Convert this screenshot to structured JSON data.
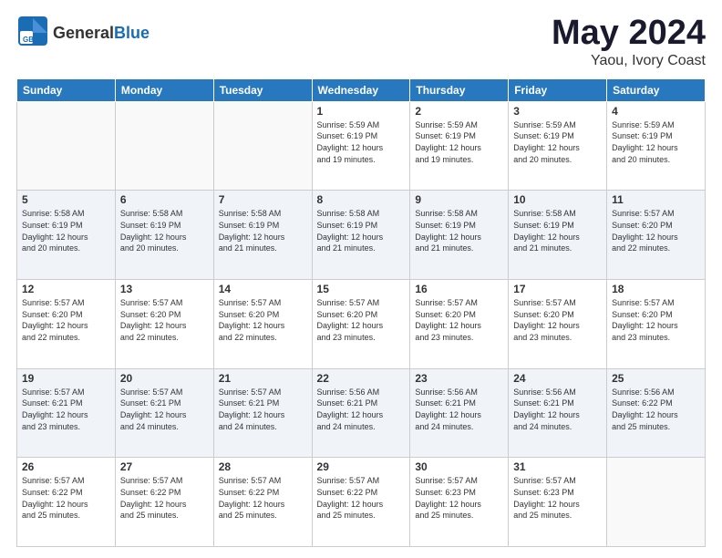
{
  "logo": {
    "general": "General",
    "blue": "Blue"
  },
  "title": "May 2024",
  "location": "Yaou, Ivory Coast",
  "days_of_week": [
    "Sunday",
    "Monday",
    "Tuesday",
    "Wednesday",
    "Thursday",
    "Friday",
    "Saturday"
  ],
  "weeks": [
    [
      {
        "day": "",
        "info": ""
      },
      {
        "day": "",
        "info": ""
      },
      {
        "day": "",
        "info": ""
      },
      {
        "day": "1",
        "info": "Sunrise: 5:59 AM\nSunset: 6:19 PM\nDaylight: 12 hours\nand 19 minutes."
      },
      {
        "day": "2",
        "info": "Sunrise: 5:59 AM\nSunset: 6:19 PM\nDaylight: 12 hours\nand 19 minutes."
      },
      {
        "day": "3",
        "info": "Sunrise: 5:59 AM\nSunset: 6:19 PM\nDaylight: 12 hours\nand 20 minutes."
      },
      {
        "day": "4",
        "info": "Sunrise: 5:59 AM\nSunset: 6:19 PM\nDaylight: 12 hours\nand 20 minutes."
      }
    ],
    [
      {
        "day": "5",
        "info": "Sunrise: 5:58 AM\nSunset: 6:19 PM\nDaylight: 12 hours\nand 20 minutes."
      },
      {
        "day": "6",
        "info": "Sunrise: 5:58 AM\nSunset: 6:19 PM\nDaylight: 12 hours\nand 20 minutes."
      },
      {
        "day": "7",
        "info": "Sunrise: 5:58 AM\nSunset: 6:19 PM\nDaylight: 12 hours\nand 21 minutes."
      },
      {
        "day": "8",
        "info": "Sunrise: 5:58 AM\nSunset: 6:19 PM\nDaylight: 12 hours\nand 21 minutes."
      },
      {
        "day": "9",
        "info": "Sunrise: 5:58 AM\nSunset: 6:19 PM\nDaylight: 12 hours\nand 21 minutes."
      },
      {
        "day": "10",
        "info": "Sunrise: 5:58 AM\nSunset: 6:19 PM\nDaylight: 12 hours\nand 21 minutes."
      },
      {
        "day": "11",
        "info": "Sunrise: 5:57 AM\nSunset: 6:20 PM\nDaylight: 12 hours\nand 22 minutes."
      }
    ],
    [
      {
        "day": "12",
        "info": "Sunrise: 5:57 AM\nSunset: 6:20 PM\nDaylight: 12 hours\nand 22 minutes."
      },
      {
        "day": "13",
        "info": "Sunrise: 5:57 AM\nSunset: 6:20 PM\nDaylight: 12 hours\nand 22 minutes."
      },
      {
        "day": "14",
        "info": "Sunrise: 5:57 AM\nSunset: 6:20 PM\nDaylight: 12 hours\nand 22 minutes."
      },
      {
        "day": "15",
        "info": "Sunrise: 5:57 AM\nSunset: 6:20 PM\nDaylight: 12 hours\nand 23 minutes."
      },
      {
        "day": "16",
        "info": "Sunrise: 5:57 AM\nSunset: 6:20 PM\nDaylight: 12 hours\nand 23 minutes."
      },
      {
        "day": "17",
        "info": "Sunrise: 5:57 AM\nSunset: 6:20 PM\nDaylight: 12 hours\nand 23 minutes."
      },
      {
        "day": "18",
        "info": "Sunrise: 5:57 AM\nSunset: 6:20 PM\nDaylight: 12 hours\nand 23 minutes."
      }
    ],
    [
      {
        "day": "19",
        "info": "Sunrise: 5:57 AM\nSunset: 6:21 PM\nDaylight: 12 hours\nand 23 minutes."
      },
      {
        "day": "20",
        "info": "Sunrise: 5:57 AM\nSunset: 6:21 PM\nDaylight: 12 hours\nand 24 minutes."
      },
      {
        "day": "21",
        "info": "Sunrise: 5:57 AM\nSunset: 6:21 PM\nDaylight: 12 hours\nand 24 minutes."
      },
      {
        "day": "22",
        "info": "Sunrise: 5:56 AM\nSunset: 6:21 PM\nDaylight: 12 hours\nand 24 minutes."
      },
      {
        "day": "23",
        "info": "Sunrise: 5:56 AM\nSunset: 6:21 PM\nDaylight: 12 hours\nand 24 minutes."
      },
      {
        "day": "24",
        "info": "Sunrise: 5:56 AM\nSunset: 6:21 PM\nDaylight: 12 hours\nand 24 minutes."
      },
      {
        "day": "25",
        "info": "Sunrise: 5:56 AM\nSunset: 6:22 PM\nDaylight: 12 hours\nand 25 minutes."
      }
    ],
    [
      {
        "day": "26",
        "info": "Sunrise: 5:57 AM\nSunset: 6:22 PM\nDaylight: 12 hours\nand 25 minutes."
      },
      {
        "day": "27",
        "info": "Sunrise: 5:57 AM\nSunset: 6:22 PM\nDaylight: 12 hours\nand 25 minutes."
      },
      {
        "day": "28",
        "info": "Sunrise: 5:57 AM\nSunset: 6:22 PM\nDaylight: 12 hours\nand 25 minutes."
      },
      {
        "day": "29",
        "info": "Sunrise: 5:57 AM\nSunset: 6:22 PM\nDaylight: 12 hours\nand 25 minutes."
      },
      {
        "day": "30",
        "info": "Sunrise: 5:57 AM\nSunset: 6:23 PM\nDaylight: 12 hours\nand 25 minutes."
      },
      {
        "day": "31",
        "info": "Sunrise: 5:57 AM\nSunset: 6:23 PM\nDaylight: 12 hours\nand 25 minutes."
      },
      {
        "day": "",
        "info": ""
      }
    ]
  ]
}
